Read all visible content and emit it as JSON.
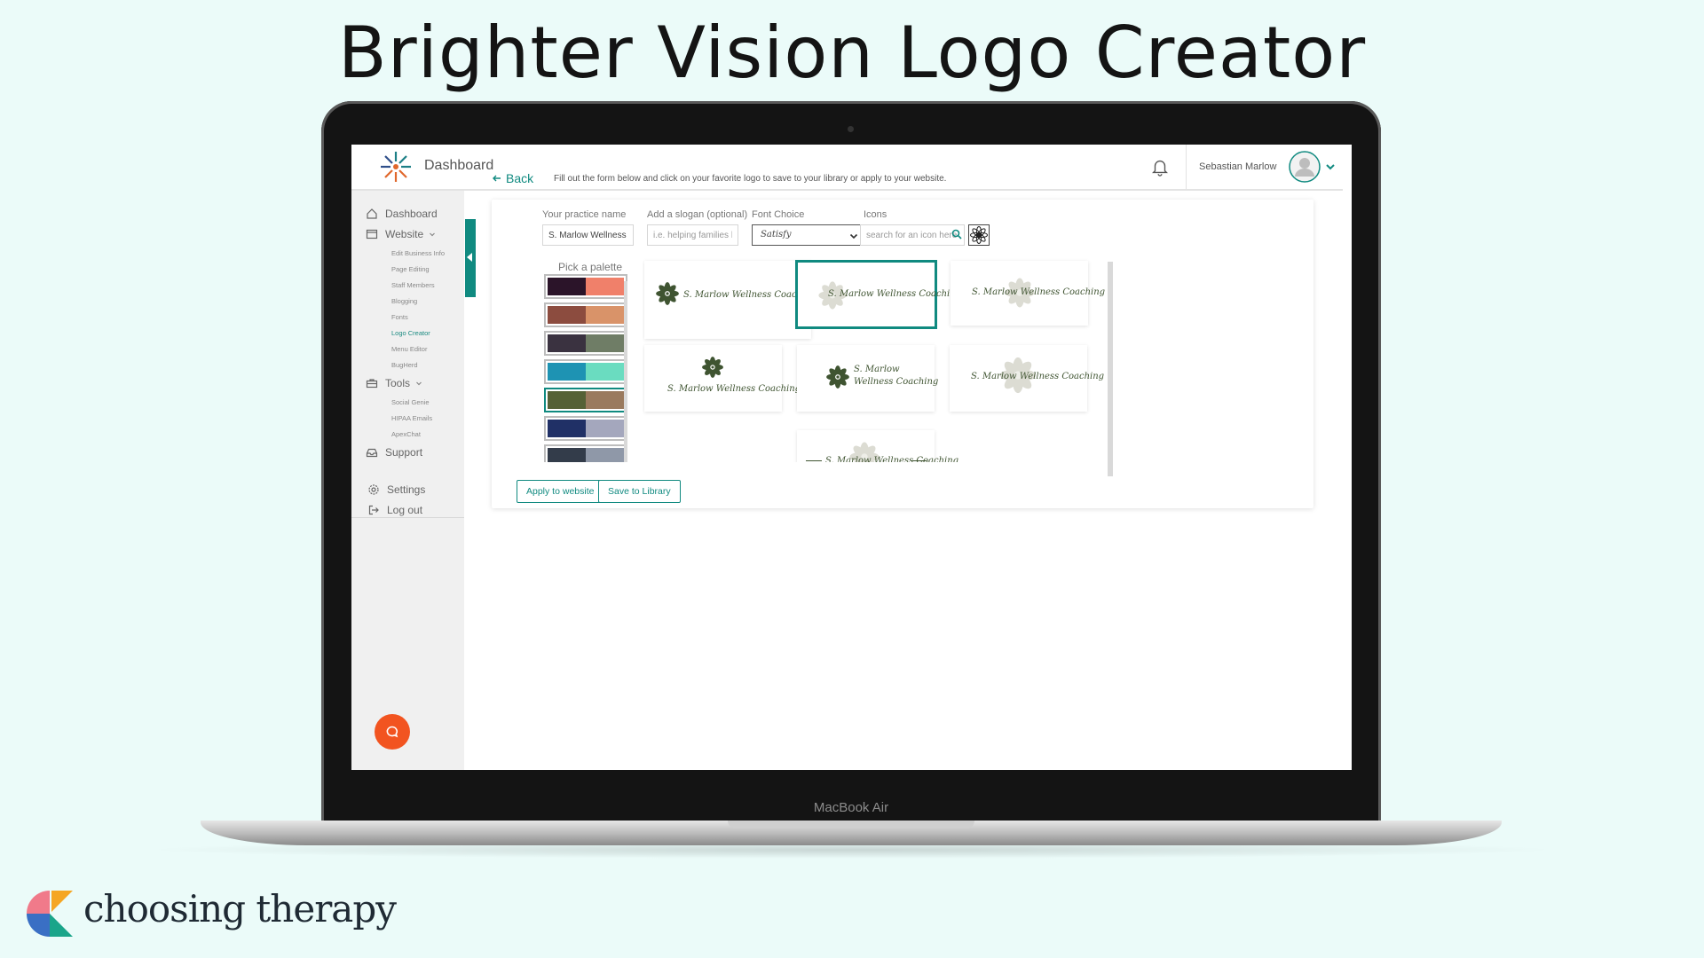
{
  "page": {
    "title": "Brighter Vision Logo Creator",
    "laptop_brand": "MacBook Air",
    "footer_brand": "choosing therapy"
  },
  "header": {
    "title": "Dashboard",
    "user_name": "Sebastian Marlow"
  },
  "sidebar": {
    "items": [
      {
        "label": "Dashboard",
        "icon": "home-icon"
      },
      {
        "label": "Website",
        "icon": "browser-window-icon"
      },
      {
        "label": "Tools",
        "icon": "toolbox-icon"
      },
      {
        "label": "Support",
        "icon": "inbox-icon"
      },
      {
        "label": "Settings",
        "icon": "gear-icon"
      },
      {
        "label": "Log out",
        "icon": "logout-icon"
      }
    ],
    "website_sub": [
      "Edit Business Info",
      "Page Editing",
      "Staff Members",
      "Blogging",
      "Fonts",
      "Logo Creator",
      "Menu Editor",
      "BugHerd"
    ],
    "tools_sub": [
      "Social Genie",
      "HIPAA Emails",
      "ApexChat"
    ],
    "active_sub": "Logo Creator"
  },
  "main": {
    "back_label": "Back",
    "instructions": "Fill out the form below and click on your favorite logo to save to your library or apply to your website.",
    "form": {
      "practice_name_label": "Your practice name",
      "practice_name_value": "S. Marlow Wellness Co",
      "slogan_label": "Add a slogan (optional)",
      "slogan_placeholder": "i.e. helping families heal",
      "font_label": "Font Choice",
      "font_value": "Satisfy",
      "icons_label": "Icons",
      "icons_placeholder": "search for an icon here"
    },
    "palette": {
      "title": "Pick a palette",
      "selected_index": 4,
      "swatches": [
        [
          "#2b1429",
          "#f0806a"
        ],
        [
          "#8c4c3f",
          "#d99369"
        ],
        [
          "#3a3240",
          "#6f7d66"
        ],
        [
          "#1e93b3",
          "#6adcc0"
        ],
        [
          "#556136",
          "#9a7a5e"
        ],
        [
          "#203066",
          "#a4a7bd"
        ],
        [
          "#333c4a",
          "#8f98a8"
        ]
      ]
    },
    "logo_text": "S. Marlow Wellness Coaching",
    "logo_text_line1": "S. Marlow",
    "logo_text_line2": "Wellness Coaching",
    "buttons": {
      "apply": "Apply to website",
      "save": "Save to Library"
    }
  },
  "colors": {
    "accent": "#108a80",
    "help_button": "#f25420",
    "logo_dark": "#3f5431",
    "logo_light": "#d8d8cf"
  }
}
